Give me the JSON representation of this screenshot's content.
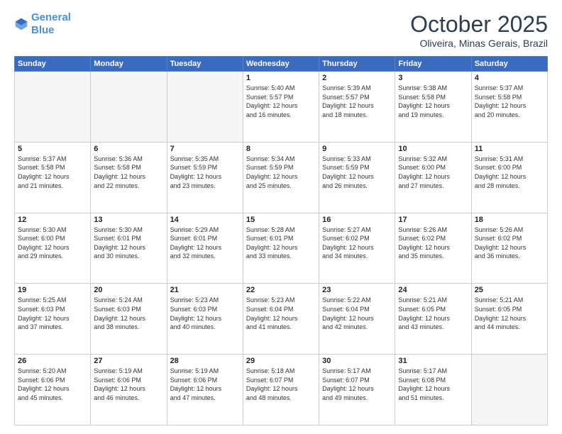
{
  "header": {
    "logo_line1": "General",
    "logo_line2": "Blue",
    "month": "October 2025",
    "location": "Oliveira, Minas Gerais, Brazil"
  },
  "weekdays": [
    "Sunday",
    "Monday",
    "Tuesday",
    "Wednesday",
    "Thursday",
    "Friday",
    "Saturday"
  ],
  "weeks": [
    [
      {
        "day": "",
        "info": ""
      },
      {
        "day": "",
        "info": ""
      },
      {
        "day": "",
        "info": ""
      },
      {
        "day": "1",
        "info": "Sunrise: 5:40 AM\nSunset: 5:57 PM\nDaylight: 12 hours\nand 16 minutes."
      },
      {
        "day": "2",
        "info": "Sunrise: 5:39 AM\nSunset: 5:57 PM\nDaylight: 12 hours\nand 18 minutes."
      },
      {
        "day": "3",
        "info": "Sunrise: 5:38 AM\nSunset: 5:58 PM\nDaylight: 12 hours\nand 19 minutes."
      },
      {
        "day": "4",
        "info": "Sunrise: 5:37 AM\nSunset: 5:58 PM\nDaylight: 12 hours\nand 20 minutes."
      }
    ],
    [
      {
        "day": "5",
        "info": "Sunrise: 5:37 AM\nSunset: 5:58 PM\nDaylight: 12 hours\nand 21 minutes."
      },
      {
        "day": "6",
        "info": "Sunrise: 5:36 AM\nSunset: 5:58 PM\nDaylight: 12 hours\nand 22 minutes."
      },
      {
        "day": "7",
        "info": "Sunrise: 5:35 AM\nSunset: 5:59 PM\nDaylight: 12 hours\nand 23 minutes."
      },
      {
        "day": "8",
        "info": "Sunrise: 5:34 AM\nSunset: 5:59 PM\nDaylight: 12 hours\nand 25 minutes."
      },
      {
        "day": "9",
        "info": "Sunrise: 5:33 AM\nSunset: 5:59 PM\nDaylight: 12 hours\nand 26 minutes."
      },
      {
        "day": "10",
        "info": "Sunrise: 5:32 AM\nSunset: 6:00 PM\nDaylight: 12 hours\nand 27 minutes."
      },
      {
        "day": "11",
        "info": "Sunrise: 5:31 AM\nSunset: 6:00 PM\nDaylight: 12 hours\nand 28 minutes."
      }
    ],
    [
      {
        "day": "12",
        "info": "Sunrise: 5:30 AM\nSunset: 6:00 PM\nDaylight: 12 hours\nand 29 minutes."
      },
      {
        "day": "13",
        "info": "Sunrise: 5:30 AM\nSunset: 6:01 PM\nDaylight: 12 hours\nand 30 minutes."
      },
      {
        "day": "14",
        "info": "Sunrise: 5:29 AM\nSunset: 6:01 PM\nDaylight: 12 hours\nand 32 minutes."
      },
      {
        "day": "15",
        "info": "Sunrise: 5:28 AM\nSunset: 6:01 PM\nDaylight: 12 hours\nand 33 minutes."
      },
      {
        "day": "16",
        "info": "Sunrise: 5:27 AM\nSunset: 6:02 PM\nDaylight: 12 hours\nand 34 minutes."
      },
      {
        "day": "17",
        "info": "Sunrise: 5:26 AM\nSunset: 6:02 PM\nDaylight: 12 hours\nand 35 minutes."
      },
      {
        "day": "18",
        "info": "Sunrise: 5:26 AM\nSunset: 6:02 PM\nDaylight: 12 hours\nand 36 minutes."
      }
    ],
    [
      {
        "day": "19",
        "info": "Sunrise: 5:25 AM\nSunset: 6:03 PM\nDaylight: 12 hours\nand 37 minutes."
      },
      {
        "day": "20",
        "info": "Sunrise: 5:24 AM\nSunset: 6:03 PM\nDaylight: 12 hours\nand 38 minutes."
      },
      {
        "day": "21",
        "info": "Sunrise: 5:23 AM\nSunset: 6:03 PM\nDaylight: 12 hours\nand 40 minutes."
      },
      {
        "day": "22",
        "info": "Sunrise: 5:23 AM\nSunset: 6:04 PM\nDaylight: 12 hours\nand 41 minutes."
      },
      {
        "day": "23",
        "info": "Sunrise: 5:22 AM\nSunset: 6:04 PM\nDaylight: 12 hours\nand 42 minutes."
      },
      {
        "day": "24",
        "info": "Sunrise: 5:21 AM\nSunset: 6:05 PM\nDaylight: 12 hours\nand 43 minutes."
      },
      {
        "day": "25",
        "info": "Sunrise: 5:21 AM\nSunset: 6:05 PM\nDaylight: 12 hours\nand 44 minutes."
      }
    ],
    [
      {
        "day": "26",
        "info": "Sunrise: 5:20 AM\nSunset: 6:06 PM\nDaylight: 12 hours\nand 45 minutes."
      },
      {
        "day": "27",
        "info": "Sunrise: 5:19 AM\nSunset: 6:06 PM\nDaylight: 12 hours\nand 46 minutes."
      },
      {
        "day": "28",
        "info": "Sunrise: 5:19 AM\nSunset: 6:06 PM\nDaylight: 12 hours\nand 47 minutes."
      },
      {
        "day": "29",
        "info": "Sunrise: 5:18 AM\nSunset: 6:07 PM\nDaylight: 12 hours\nand 48 minutes."
      },
      {
        "day": "30",
        "info": "Sunrise: 5:17 AM\nSunset: 6:07 PM\nDaylight: 12 hours\nand 49 minutes."
      },
      {
        "day": "31",
        "info": "Sunrise: 5:17 AM\nSunset: 6:08 PM\nDaylight: 12 hours\nand 51 minutes."
      },
      {
        "day": "",
        "info": ""
      }
    ]
  ]
}
